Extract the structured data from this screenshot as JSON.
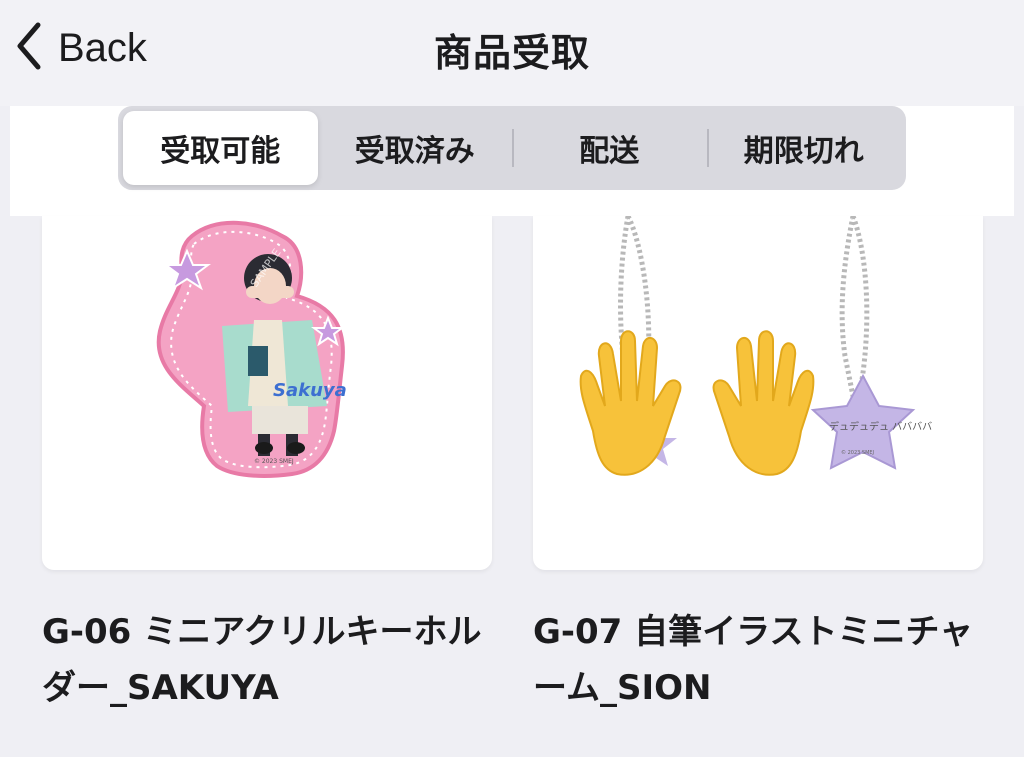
{
  "header": {
    "back_label": "Back",
    "title": "商品受取"
  },
  "tabs": [
    {
      "label": "受取可能",
      "active": true
    },
    {
      "label": "受取済み",
      "active": false
    },
    {
      "label": "配送",
      "active": false
    },
    {
      "label": "期限切れ",
      "active": false
    }
  ],
  "products": [
    {
      "name": "G-06 ミニアクリルキーホルダー_SAKUYA",
      "image_text": "Sakuya",
      "watermark": "SAMPLE",
      "copyright": "© 2023 SMEJ"
    },
    {
      "name": "G-07 自筆イラストミニチャーム_SION",
      "image_text": "デュデュデュ ババババ",
      "copyright": "© 2023 SMEJ"
    }
  ],
  "colors": {
    "background": "#efeff4",
    "segment_bg": "#d9d9df",
    "acrylic_border": "#e87aa6",
    "hand": "#f7c23a",
    "star": "#c4b6e6"
  }
}
